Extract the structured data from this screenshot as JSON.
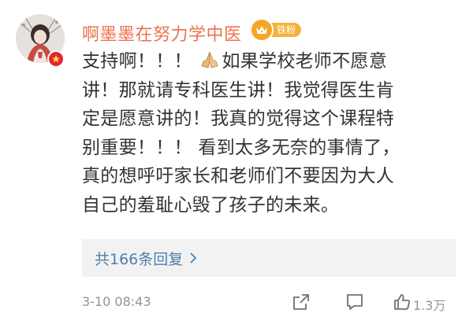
{
  "comment": {
    "username": "啊墨墨在努力学中医",
    "fan_badge": "铁粉",
    "lines": [
      "支持啊！！！",
      "如果学校老师不愿意",
      "讲！那就请专科医生讲！我觉得医生肯",
      "定是愿意讲的！我真的觉得这个课程特",
      "别重要！！！ 看到太多无奈的事情了，",
      "真的想呼吁家长和老师们不要因为大人",
      "自己的羞耻心毁了孩子的未来。"
    ],
    "emoji": "pray-hands-emoji",
    "replies_link": "共166条回复",
    "timestamp": "3-10 08:43",
    "like_count": "1.3万"
  },
  "colors": {
    "username": "#eb7350",
    "link": "#507daf",
    "meta": "#939393",
    "badge": "#f6b13a",
    "verified": "#e3262f"
  },
  "icons": [
    "verified-badge-icon",
    "crown-icon",
    "chevron-right-icon",
    "share-icon",
    "comment-icon",
    "like-icon"
  ]
}
